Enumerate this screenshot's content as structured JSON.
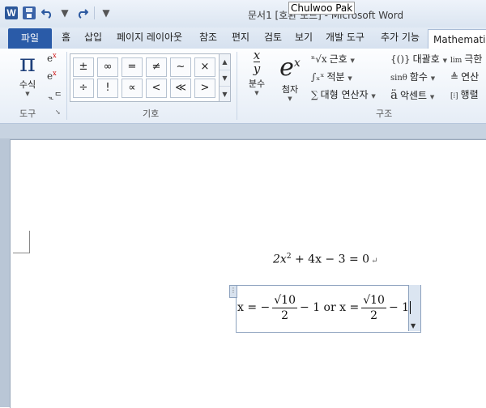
{
  "window": {
    "title": "문서1 [호환 모드] - Microsoft Word",
    "tooltip_user": "Chulwoo Pak"
  },
  "qat": {
    "app_icon": "W",
    "save_icon": "save-icon",
    "undo_icon": "undo-icon",
    "redo_icon": "redo-icon"
  },
  "tabs": {
    "file": "파일",
    "items": [
      "홈",
      "삽입",
      "페이지 레이아웃",
      "참조",
      "편지",
      "검토",
      "보기",
      "개발 도구",
      "추가 기능"
    ],
    "active": "Mathematics"
  },
  "ribbon": {
    "tools": {
      "equation_label": "수식",
      "equation_symbol": "π",
      "group_label": "도구"
    },
    "symbols": {
      "items": [
        "±",
        "∞",
        "=",
        "≠",
        "~",
        "×",
        "÷",
        "!",
        "∝",
        "<",
        "≪",
        ">"
      ],
      "group_label": "기호"
    },
    "structures": {
      "fraction_label": "분수",
      "script_label": "첨자",
      "radical_label": "근호",
      "integral_label": "적분",
      "large_operator_label": "대형 연산자",
      "bracket_label": "대괄호",
      "function_label": "함수",
      "accent_label": "악센트",
      "limit_label": "극한",
      "operator_label": "연산",
      "matrix_label": "행렬",
      "function_icon_text": "sinθ",
      "limit_icon_text": "lim",
      "group_label": "구조"
    }
  },
  "document": {
    "equation1": {
      "a": "2x",
      "exp": "2",
      "rest": " + 4x − 3 = 0"
    },
    "equation2": {
      "lhs1": "x = −",
      "num1": "√10",
      "den1": "2",
      "mid": "− 1 or x =",
      "num2": "√10",
      "den2": "2",
      "end": "− 1"
    }
  }
}
